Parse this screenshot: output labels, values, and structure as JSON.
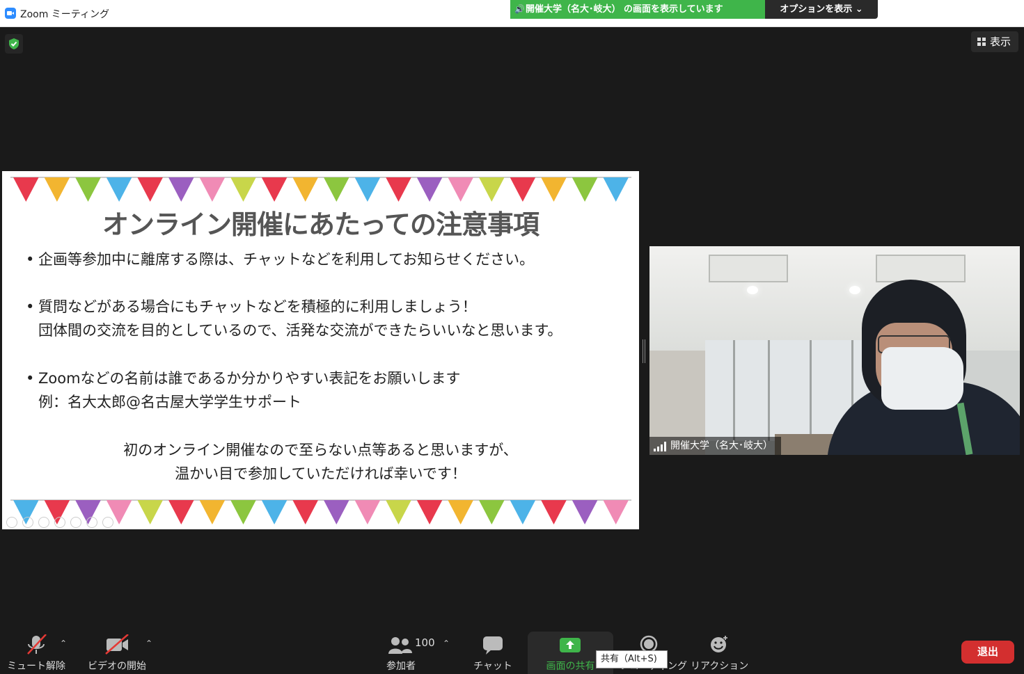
{
  "titlebar": {
    "title": "Zoom ミーティング",
    "share_banner": "開催大学（名大･岐大） の画面を表示しています",
    "options_label": "オプションを表示 ⌄"
  },
  "view_button": {
    "label": "表示"
  },
  "slide": {
    "title": "オンライン開催にあたっての注意事項",
    "bullets": [
      {
        "line1": "企画等参加中に離席する際は、チャットなどを利用してお知らせください。"
      },
      {
        "line1": "質問などがある場合にもチャットなどを積極的に利用しましょう！",
        "line2": "団体間の交流を目的としているので、活発な交流ができたらいいなと思います。"
      },
      {
        "line1": "Zoomなどの名前は誰であるか分かりやすい表記をお願いします",
        "line2": "例：名大太郎@名古屋大学学生サポート"
      }
    ],
    "closing": {
      "line1": "初のオンライン開催なので至らない点等あると思いますが、",
      "line2": "温かい目で参加していただければ幸いです！"
    },
    "bullet_char": "•"
  },
  "video": {
    "participant_name": "開催大学（名大･岐大）"
  },
  "toolbar": {
    "mute_label": "ミュート解除",
    "video_label": "ビデオの開始",
    "participants_label": "参加者",
    "participants_count": "100",
    "chat_label": "チャット",
    "share_label": "画面の共有",
    "record_label": "レコーディング",
    "reaction_label": "リアクション",
    "leave_label": "退出",
    "share_tooltip": "共有（Alt+S)",
    "caret": "⌃"
  },
  "colors": {
    "background": "#1a1a1a",
    "share_green": "#3fb54a",
    "leave_red": "#d32f2f",
    "accent_blue": "#2d8cff"
  },
  "icons": [
    "zoom-logo-icon",
    "speaker-icon",
    "shield-icon",
    "grid-view-icon",
    "signal-icon",
    "mic-muted-icon",
    "video-off-icon",
    "participants-icon",
    "chat-icon",
    "share-screen-icon",
    "record-icon",
    "reaction-icon"
  ]
}
